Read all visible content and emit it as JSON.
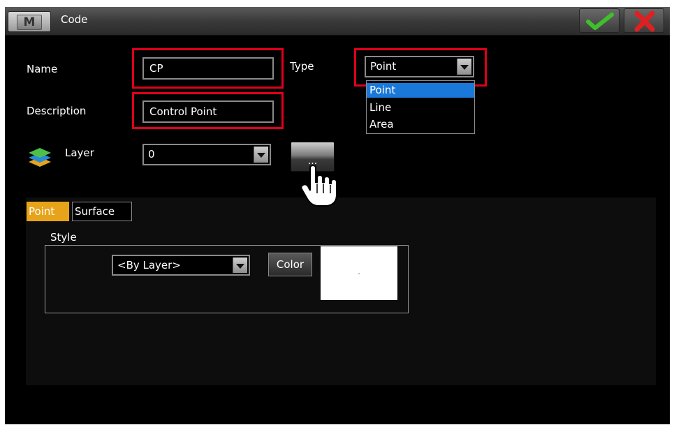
{
  "window": {
    "title": "Code",
    "menu_letter": "M"
  },
  "form": {
    "name": {
      "label": "Name",
      "value": "CP"
    },
    "description": {
      "label": "Description",
      "value": "Control Point"
    },
    "type": {
      "label": "Type",
      "value": "Point",
      "options": [
        "Point",
        "Line",
        "Area"
      ],
      "selected": "Point"
    },
    "layer": {
      "label": "Layer",
      "value": "0",
      "more_label": "..."
    }
  },
  "tabs": [
    {
      "label": "Point",
      "active": true
    },
    {
      "label": "Surface",
      "active": false
    }
  ],
  "style": {
    "group_label": "Style",
    "value": "<By Layer>",
    "color_button_label": "Color",
    "color_value": "#ffffff"
  },
  "icons": {
    "ok": "check-icon",
    "cancel": "close-icon",
    "layer": "layers-icon",
    "dropdown": "chevron-down-icon",
    "cursor": "hand-pointer-icon"
  },
  "colors": {
    "highlight_outline": "#e0001b",
    "active_tab": "#e7a31a",
    "selection": "#1a78d8",
    "ok_green": "#3fbf2a",
    "cancel_red": "#e02020"
  }
}
